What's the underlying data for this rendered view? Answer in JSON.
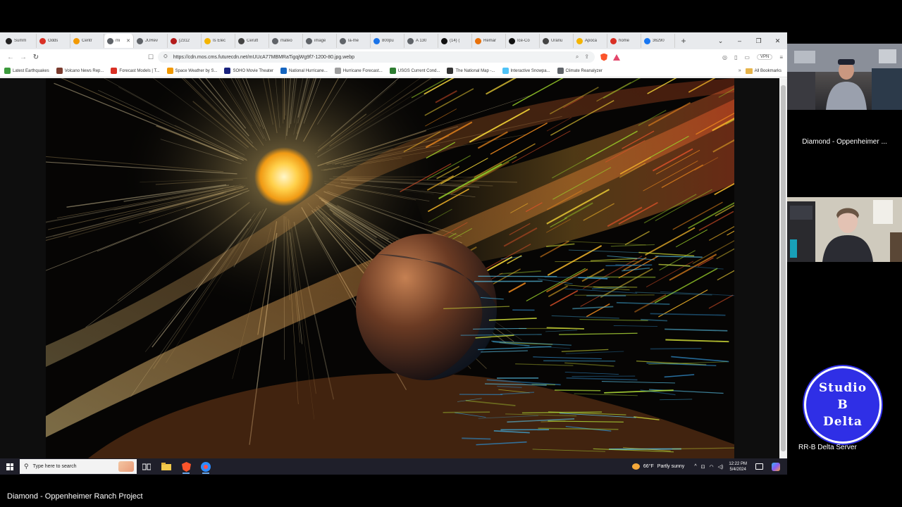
{
  "browser": {
    "tabs": [
      {
        "title": "Summ",
        "icon": "github-icon",
        "color": "#222222"
      },
      {
        "title": "Odds",
        "icon": "e-icon",
        "color": "#d93025"
      },
      {
        "title": "Centr",
        "icon": "site-icon",
        "color": "#f29900"
      },
      {
        "title": "mi",
        "icon": "globe-icon",
        "color": "#5f6368",
        "active": true
      },
      {
        "title": "JURev",
        "icon": "globe-icon",
        "color": "#5f6368"
      },
      {
        "title": "[2312",
        "icon": "x-icon",
        "color": "#b31b1b"
      },
      {
        "title": "Is Elec",
        "icon": "site-icon",
        "color": "#f4b400"
      },
      {
        "title": "Cerutt",
        "icon": "wikipedia-icon",
        "color": "#444444"
      },
      {
        "title": "mateo",
        "icon": "globe-icon",
        "color": "#5f6368"
      },
      {
        "title": "image",
        "icon": "search-icon",
        "color": "#5f6368"
      },
      {
        "title": "la-me",
        "icon": "globe-icon",
        "color": "#5f6368"
      },
      {
        "title": "800pu",
        "icon": "globe-icon",
        "color": "#1a73e8"
      },
      {
        "title": "A 130",
        "icon": "globe-icon",
        "color": "#5f6368"
      },
      {
        "title": "(14) (",
        "icon": "x-icon",
        "color": "#111111"
      },
      {
        "title": "Remar",
        "icon": "site-icon",
        "color": "#e8710a"
      },
      {
        "title": "Ice-Co",
        "icon": "x-icon",
        "color": "#111111"
      },
      {
        "title": "Uranu",
        "icon": "wikipedia-icon",
        "color": "#444444"
      },
      {
        "title": "Apoca",
        "icon": "site-icon",
        "color": "#f4b400"
      },
      {
        "title": "home",
        "icon": "site-icon",
        "color": "#d93025"
      },
      {
        "title": "36290",
        "icon": "facebook-icon",
        "color": "#1877f2"
      }
    ],
    "new_tab": "+",
    "window_controls": {
      "chevron": "⌄",
      "minimize": "–",
      "maximize": "❐",
      "close": "✕"
    },
    "url": "https://cdn.mos.cms.futurecdn.net/mUUcA77MBMRaTigqjWg9f7-1200-80.jpg.webp",
    "vpn_label": "VPN",
    "bookmarks": [
      {
        "label": "Latest Earthquakes",
        "color": "#3c9a3c"
      },
      {
        "label": "Volcano News Rep...",
        "color": "#7a3b2e"
      },
      {
        "label": "Forecast Models | T...",
        "color": "#d93025"
      },
      {
        "label": "Space Weather by S...",
        "color": "#f29900"
      },
      {
        "label": "SOHO Movie Theater",
        "color": "#1a237e"
      },
      {
        "label": "National Hurricane...",
        "color": "#1565c0"
      },
      {
        "label": "Hurricane Forecast...",
        "color": "#9e9e9e"
      },
      {
        "label": "USGS Current Cond...",
        "color": "#2e7d32"
      },
      {
        "label": "The National Map -...",
        "color": "#333333"
      },
      {
        "label": "Interactive Snowpa...",
        "color": "#4fc3f7"
      },
      {
        "label": "Climate Reanalyzer",
        "color": "#5f6368"
      }
    ],
    "bookmarks_more": "»",
    "all_bookmarks": "All Bookmarks"
  },
  "taskbar": {
    "search_placeholder": "Type here to search",
    "weather_temp": "66°F",
    "weather_text": "Partly sunny",
    "tray_up": "^",
    "clock_time": "12:22 PM",
    "clock_date": "5/4/2024"
  },
  "participants": {
    "cam1_name": "Diamond - Oppenheimer ...",
    "server_name": "RR-B Delta Server",
    "bottom_name": "Diamond - Oppenheimer Ranch Project"
  },
  "logo": {
    "line1": "Studio",
    "line2": "B",
    "line3": "Delta"
  }
}
